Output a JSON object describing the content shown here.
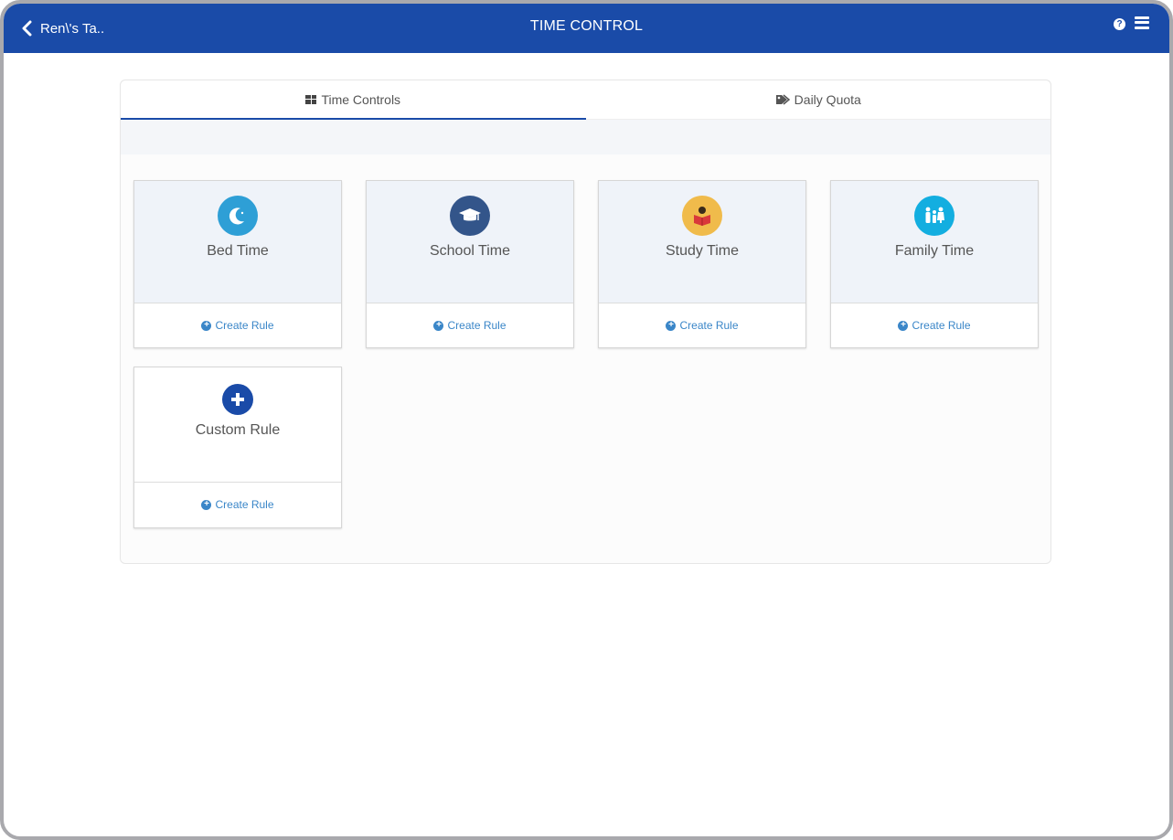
{
  "header": {
    "back_label": "Ren\\'s Ta..",
    "title": "TIME CONTROL",
    "help_icon": "question-circle-icon",
    "menu_icon": "hamburger-menu-icon",
    "bar_color": "#1a4ba8"
  },
  "tabs": [
    {
      "label": "Time Controls",
      "icon": "grid-icon",
      "active": true
    },
    {
      "label": "Daily Quota",
      "icon": "tags-icon",
      "active": false
    }
  ],
  "cards": [
    {
      "title": "Bed Time",
      "icon": "moon-icon",
      "icon_color": "#2e9fd6",
      "action": "Create Rule"
    },
    {
      "title": "School Time",
      "icon": "graduation-cap-icon",
      "icon_color": "#33558a",
      "action": "Create Rule"
    },
    {
      "title": "Study Time",
      "icon": "reading-person-icon",
      "icon_color": "#f0bb4b",
      "action": "Create Rule"
    },
    {
      "title": "Family Time",
      "icon": "family-icon",
      "icon_color": "#13aee0",
      "action": "Create Rule"
    },
    {
      "title": "Custom Rule",
      "icon": "plus-circle-icon",
      "icon_color": "#1a4ba8",
      "action": "Create Rule"
    }
  ],
  "colors": {
    "accent": "#1a4ba8",
    "link": "#3a86c8"
  }
}
